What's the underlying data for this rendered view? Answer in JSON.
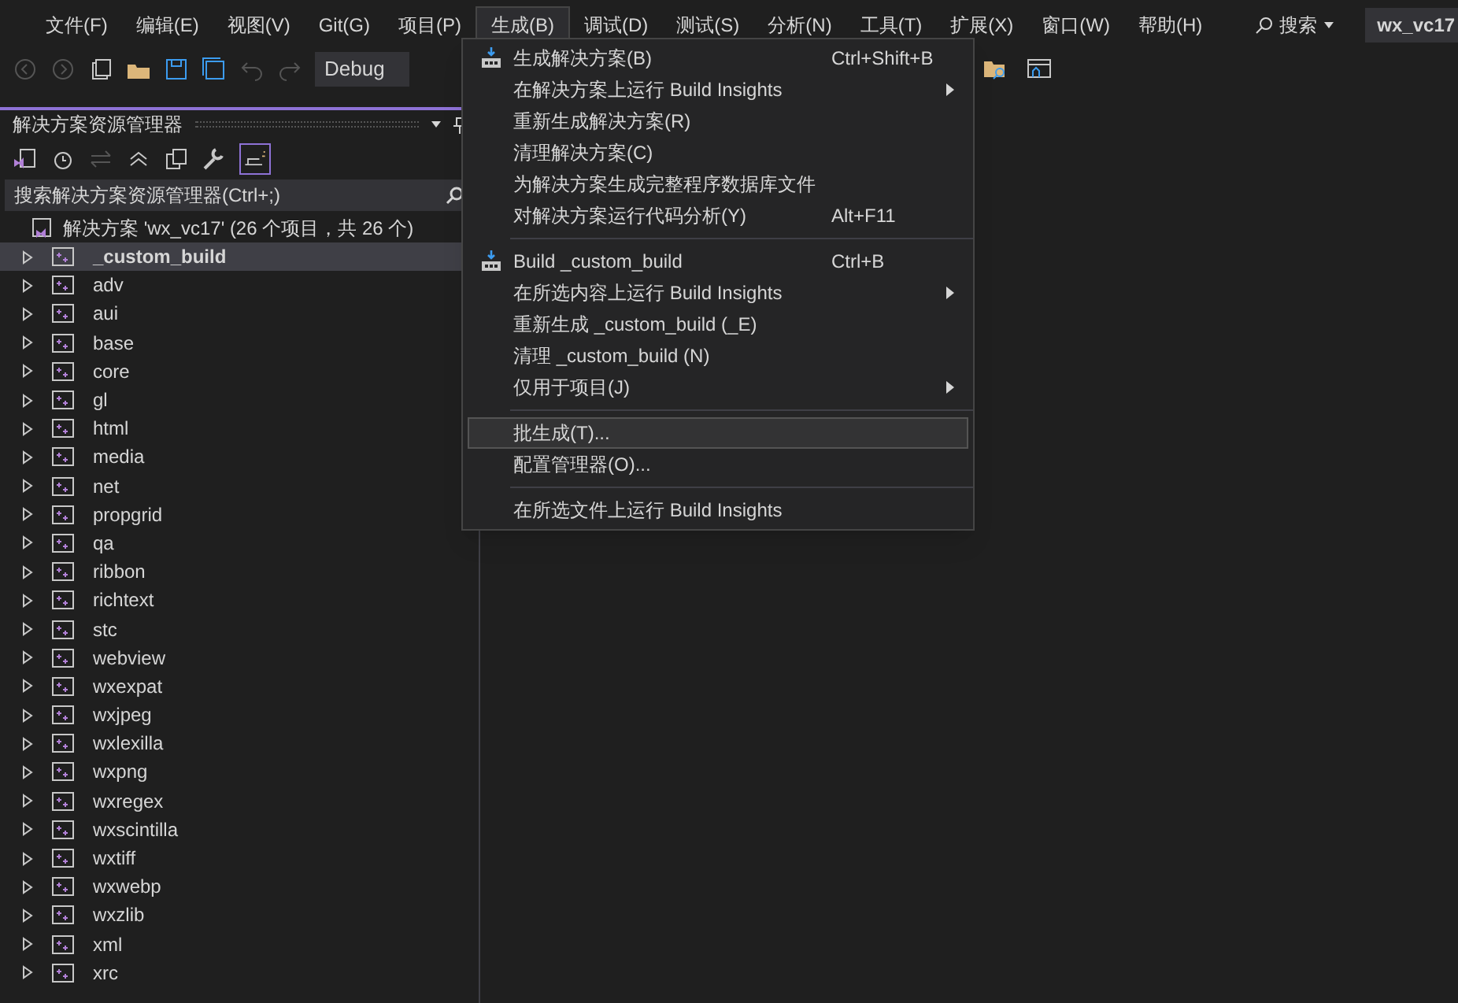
{
  "menubar": {
    "items": [
      {
        "label": "文件(F)",
        "selected": false
      },
      {
        "label": "编辑(E)",
        "selected": false
      },
      {
        "label": "视图(V)",
        "selected": false
      },
      {
        "label": "Git(G)",
        "selected": false
      },
      {
        "label": "项目(P)",
        "selected": false
      },
      {
        "label": "生成(B)",
        "selected": true
      },
      {
        "label": "调试(D)",
        "selected": false
      },
      {
        "label": "测试(S)",
        "selected": false
      },
      {
        "label": "分析(N)",
        "selected": false
      },
      {
        "label": "工具(T)",
        "selected": false
      },
      {
        "label": "扩展(X)",
        "selected": false
      },
      {
        "label": "窗口(W)",
        "selected": false
      },
      {
        "label": "帮助(H)",
        "selected": false
      }
    ],
    "search": "搜索",
    "title": "wx_vc17"
  },
  "toolbar": {
    "configuration": "Debug"
  },
  "solution_explorer": {
    "title": "解决方案资源管理器",
    "search": {
      "placeholder": "搜索解决方案资源管理器(Ctrl+;)"
    },
    "root": "解决方案 'wx_vc17' (26 个项目，共 26 个)",
    "projects": [
      {
        "name": "_custom_build",
        "selected": true
      },
      {
        "name": "adv",
        "selected": false
      },
      {
        "name": "aui",
        "selected": false
      },
      {
        "name": "base",
        "selected": false
      },
      {
        "name": "core",
        "selected": false
      },
      {
        "name": "gl",
        "selected": false
      },
      {
        "name": "html",
        "selected": false
      },
      {
        "name": "media",
        "selected": false
      },
      {
        "name": "net",
        "selected": false
      },
      {
        "name": "propgrid",
        "selected": false
      },
      {
        "name": "qa",
        "selected": false
      },
      {
        "name": "ribbon",
        "selected": false
      },
      {
        "name": "richtext",
        "selected": false
      },
      {
        "name": "stc",
        "selected": false
      },
      {
        "name": "webview",
        "selected": false
      },
      {
        "name": "wxexpat",
        "selected": false
      },
      {
        "name": "wxjpeg",
        "selected": false
      },
      {
        "name": "wxlexilla",
        "selected": false
      },
      {
        "name": "wxpng",
        "selected": false
      },
      {
        "name": "wxregex",
        "selected": false
      },
      {
        "name": "wxscintilla",
        "selected": false
      },
      {
        "name": "wxtiff",
        "selected": false
      },
      {
        "name": "wxwebp",
        "selected": false
      },
      {
        "name": "wxzlib",
        "selected": false
      },
      {
        "name": "xml",
        "selected": false
      },
      {
        "name": "xrc",
        "selected": false
      }
    ]
  },
  "build_menu": [
    {
      "kind": "item",
      "label": "生成解决方案(B)",
      "shortcut": "Ctrl+Shift+B",
      "icon": true,
      "selected": false
    },
    {
      "kind": "submenu",
      "label": "在解决方案上运行 Build Insights",
      "selected": false
    },
    {
      "kind": "item",
      "label": "重新生成解决方案(R)",
      "selected": false
    },
    {
      "kind": "item",
      "label": "清理解决方案(C)",
      "selected": false
    },
    {
      "kind": "item",
      "label": "为解决方案生成完整程序数据库文件",
      "selected": false
    },
    {
      "kind": "item",
      "label": "对解决方案运行代码分析(Y)",
      "shortcut": "Alt+F11",
      "selected": false
    },
    {
      "kind": "separator"
    },
    {
      "kind": "item",
      "label": "Build _custom_build",
      "shortcut": "Ctrl+B",
      "icon": true,
      "selected": false
    },
    {
      "kind": "submenu",
      "label": "在所选内容上运行 Build Insights",
      "selected": false
    },
    {
      "kind": "item",
      "label": "重新生成 _custom_build (_E)",
      "selected": false
    },
    {
      "kind": "item",
      "label": "清理 _custom_build (N)",
      "selected": false
    },
    {
      "kind": "submenu",
      "label": "仅用于项目(J)",
      "selected": false
    },
    {
      "kind": "separator"
    },
    {
      "kind": "item",
      "label": "批生成(T)...",
      "selected": true
    },
    {
      "kind": "item",
      "label": "配置管理器(O)...",
      "selected": false
    },
    {
      "kind": "separator"
    },
    {
      "kind": "item",
      "label": "在所选文件上运行 Build Insights",
      "selected": false
    }
  ]
}
